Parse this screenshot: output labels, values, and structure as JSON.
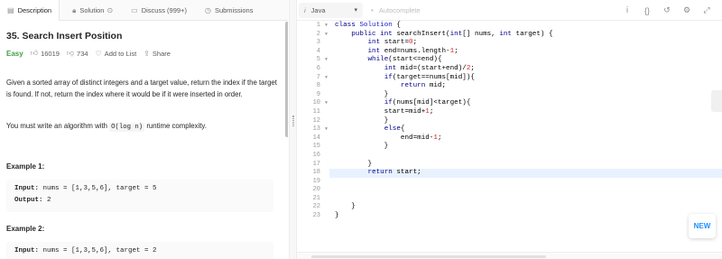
{
  "tabs": [
    {
      "label": "Description",
      "icon": "document-icon"
    },
    {
      "label": "Solution",
      "icon": "lock-icon"
    },
    {
      "label": "Discuss (999+)",
      "icon": "discuss-icon"
    },
    {
      "label": "Submissions",
      "icon": "clock-icon"
    }
  ],
  "problem": {
    "title": "35. Search Insert Position",
    "difficulty": "Easy",
    "likes": "16019",
    "dislikes": "734",
    "add_to_list": "Add to List",
    "share": "Share",
    "description": "Given a sorted array of distinct integers and a target value, return the index if the target is found. If not, return the index where it would be if it were inserted in order.",
    "complexity_prefix": "You must write an algorithm with ",
    "complexity_code": "O(log n)",
    "complexity_suffix": " runtime complexity."
  },
  "examples": [
    {
      "heading": "Example 1:",
      "input_label": "Input:",
      "input": " nums = [1,3,5,6], target = 5",
      "output_label": "Output:",
      "output": " 2"
    },
    {
      "heading": "Example 2:",
      "input_label": "Input:",
      "input": " nums = [1,3,5,6], target = 2"
    }
  ],
  "editor": {
    "language": "Java",
    "autocomplete": "Autocomplete",
    "toolbar_icons": [
      "info-icon",
      "braces-icon",
      "reset-icon",
      "settings-icon",
      "fullscreen-icon"
    ],
    "new_label": "NEW",
    "highlight_line": 18,
    "lines": [
      "class Solution {",
      "    public int searchInsert(int[] nums, int target) {",
      "        int start=0;",
      "        int end=nums.length-1;",
      "        while(start<=end){",
      "            int mid=(start+end)/2;",
      "            if(target==nums[mid]){",
      "                return mid;",
      "            }",
      "            if(nums[mid]<target){",
      "            start=mid+1;",
      "            }",
      "            else{",
      "                end=mid-1;",
      "            }",
      "",
      "        }",
      "        return start;",
      "",
      "",
      "",
      "    }",
      "}"
    ],
    "folds": [
      1,
      2,
      5,
      7,
      10,
      13
    ]
  }
}
